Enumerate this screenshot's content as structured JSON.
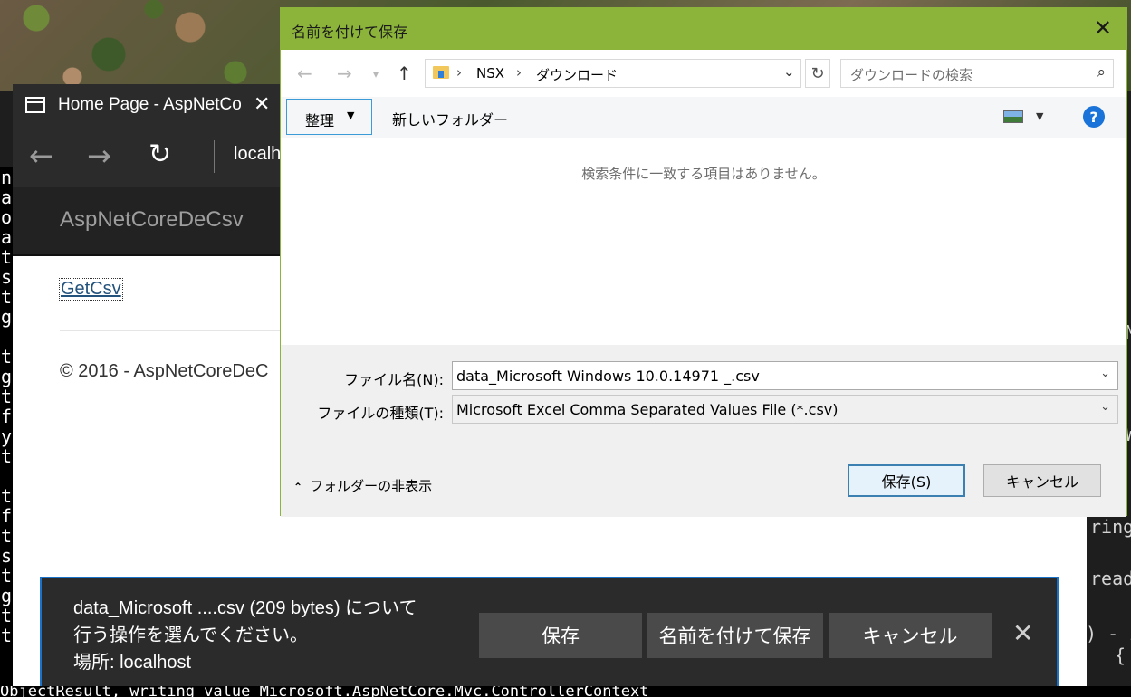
{
  "dialog": {
    "title": "名前を付けて保存",
    "breadcrumb": [
      "NSX",
      "ダウンロード"
    ],
    "search_placeholder": "ダウンロードの検索",
    "toolbar": {
      "organize_label": "整理",
      "new_folder_label": "新しいフォルダー",
      "help_label": "?"
    },
    "empty_message": "検索条件に一致する項目はありません。",
    "filename_label": "ファイル名(N):",
    "filename_value": "data_Microsoft Windows 10.0.14971 _.csv",
    "filetype_label": "ファイルの種類(T):",
    "filetype_value": "Microsoft Excel Comma Separated Values File (*.csv)",
    "hide_folders_label": "フォルダーの非表示",
    "save_label": "保存(S)",
    "cancel_label": "キャンセル"
  },
  "browser": {
    "tab_title": "Home Page - AspNetCo",
    "url": "localh",
    "site_brand": "AspNetCoreDeCsv",
    "link_label": "GetCsv",
    "footer": "© 2016 - AspNetCoreDeC"
  },
  "download_bar": {
    "message_line1": "data_Microsoft ....csv (209 bytes) について",
    "message_line2": "行う操作を選んでください。",
    "message_line3": "場所: localhost",
    "save_label": "保存",
    "save_as_label": "名前を付けて保存",
    "cancel_label": "キャンセル"
  },
  "terminal": {
    "left_chars": [
      "n",
      "a",
      "o",
      "a",
      "t",
      "s",
      "t",
      "g",
      "",
      "t",
      "g",
      "t",
      "f",
      "y",
      "t",
      "",
      "t",
      "f",
      "t",
      "s",
      "t",
      "g",
      "t",
      "t"
    ],
    "bottom_line": "ObjectResult, writing value Microsoft.AspNetCore.Mvc.ControllerContext"
  },
  "code_editor": {
    "lines": [
      "M",
      "W",
      "ring",
      "read",
      ") - if",
      "{"
    ]
  },
  "colors": {
    "dialog_accent": "#8cb33a",
    "download_bar_border": "#1a73c8",
    "link": "#23527c",
    "help": "#1a73d9"
  }
}
